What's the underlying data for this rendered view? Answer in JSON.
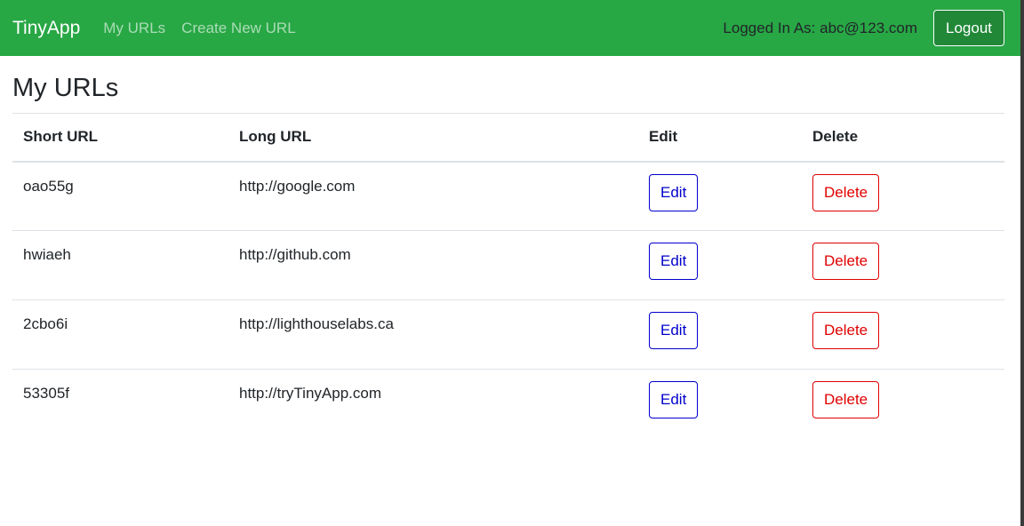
{
  "navbar": {
    "brand": "TinyApp",
    "links": [
      "My URLs",
      "Create New URL"
    ],
    "user_label": "Logged In As: abc@123.com",
    "logout_label": "Logout"
  },
  "page": {
    "title": "My URLs"
  },
  "table": {
    "headers": [
      "Short URL",
      "Long URL",
      "Edit",
      "Delete"
    ],
    "rows": [
      {
        "short": "oao55g",
        "long": "http://google.com",
        "edit": "Edit",
        "delete": "Delete"
      },
      {
        "short": "hwiaeh",
        "long": "http://github.com",
        "edit": "Edit",
        "delete": "Delete"
      },
      {
        "short": "2cbo6i",
        "long": "http://lighthouselabs.ca",
        "edit": "Edit",
        "delete": "Delete"
      },
      {
        "short": "53305f",
        "long": "http://tryTinyApp.com",
        "edit": "Edit",
        "delete": "Delete"
      }
    ]
  },
  "colors": {
    "navbar": "#28a745",
    "edit": "#0000cc",
    "delete": "#e00000"
  }
}
